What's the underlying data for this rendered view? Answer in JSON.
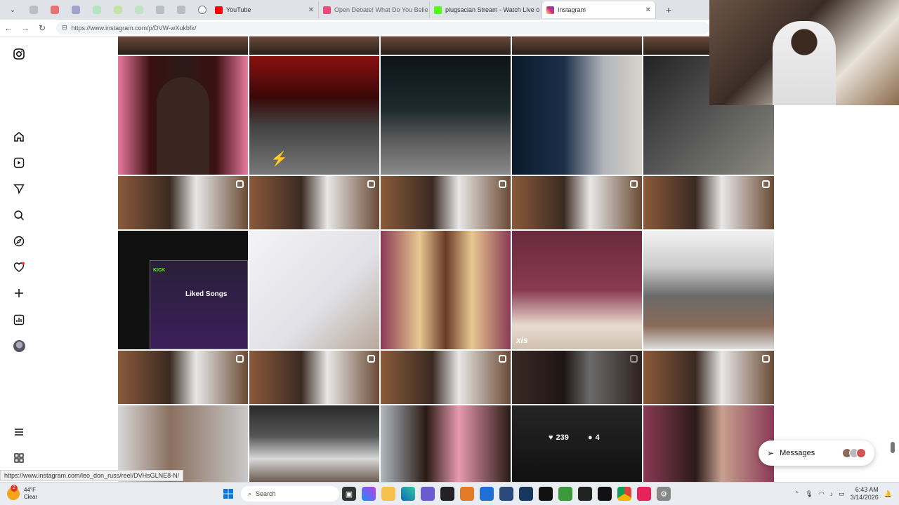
{
  "browser": {
    "tabs": [
      {
        "title": "YouTube",
        "color": "#ff0000"
      },
      {
        "title": "Open Debate! What Do You Belie",
        "color": "#e84a7a"
      },
      {
        "title": "plugsacian Stream - Watch Live o",
        "color": "#53fc18"
      },
      {
        "title": "Instagram",
        "color": "#d6249f"
      }
    ],
    "url": "https://www.instagram.com/p/DVW-wXukbfx/"
  },
  "sidebar": {
    "icons": [
      "instagram-logo-icon",
      "home-icon",
      "reels-icon",
      "messages-icon",
      "search-icon",
      "explore-icon",
      "notifications-icon",
      "create-icon",
      "dashboard-icon",
      "profile-icon",
      "menu-icon",
      "more-icon"
    ]
  },
  "grid": {
    "hover_likes": "239",
    "hover_comments": "4",
    "thumb_text_1": "Liked Songs",
    "thumb_text_2": "xis"
  },
  "status_url": "https://www.instagram.com/leo_don_russ/reel/DVHsGLNE8-N/",
  "messages_label": "Messages",
  "taskbar": {
    "weather_temp": "44°F",
    "weather_cond": "Clear",
    "weather_badge": "2",
    "search_placeholder": "Search",
    "time": "6:43 AM",
    "date": "3/14/2026"
  }
}
